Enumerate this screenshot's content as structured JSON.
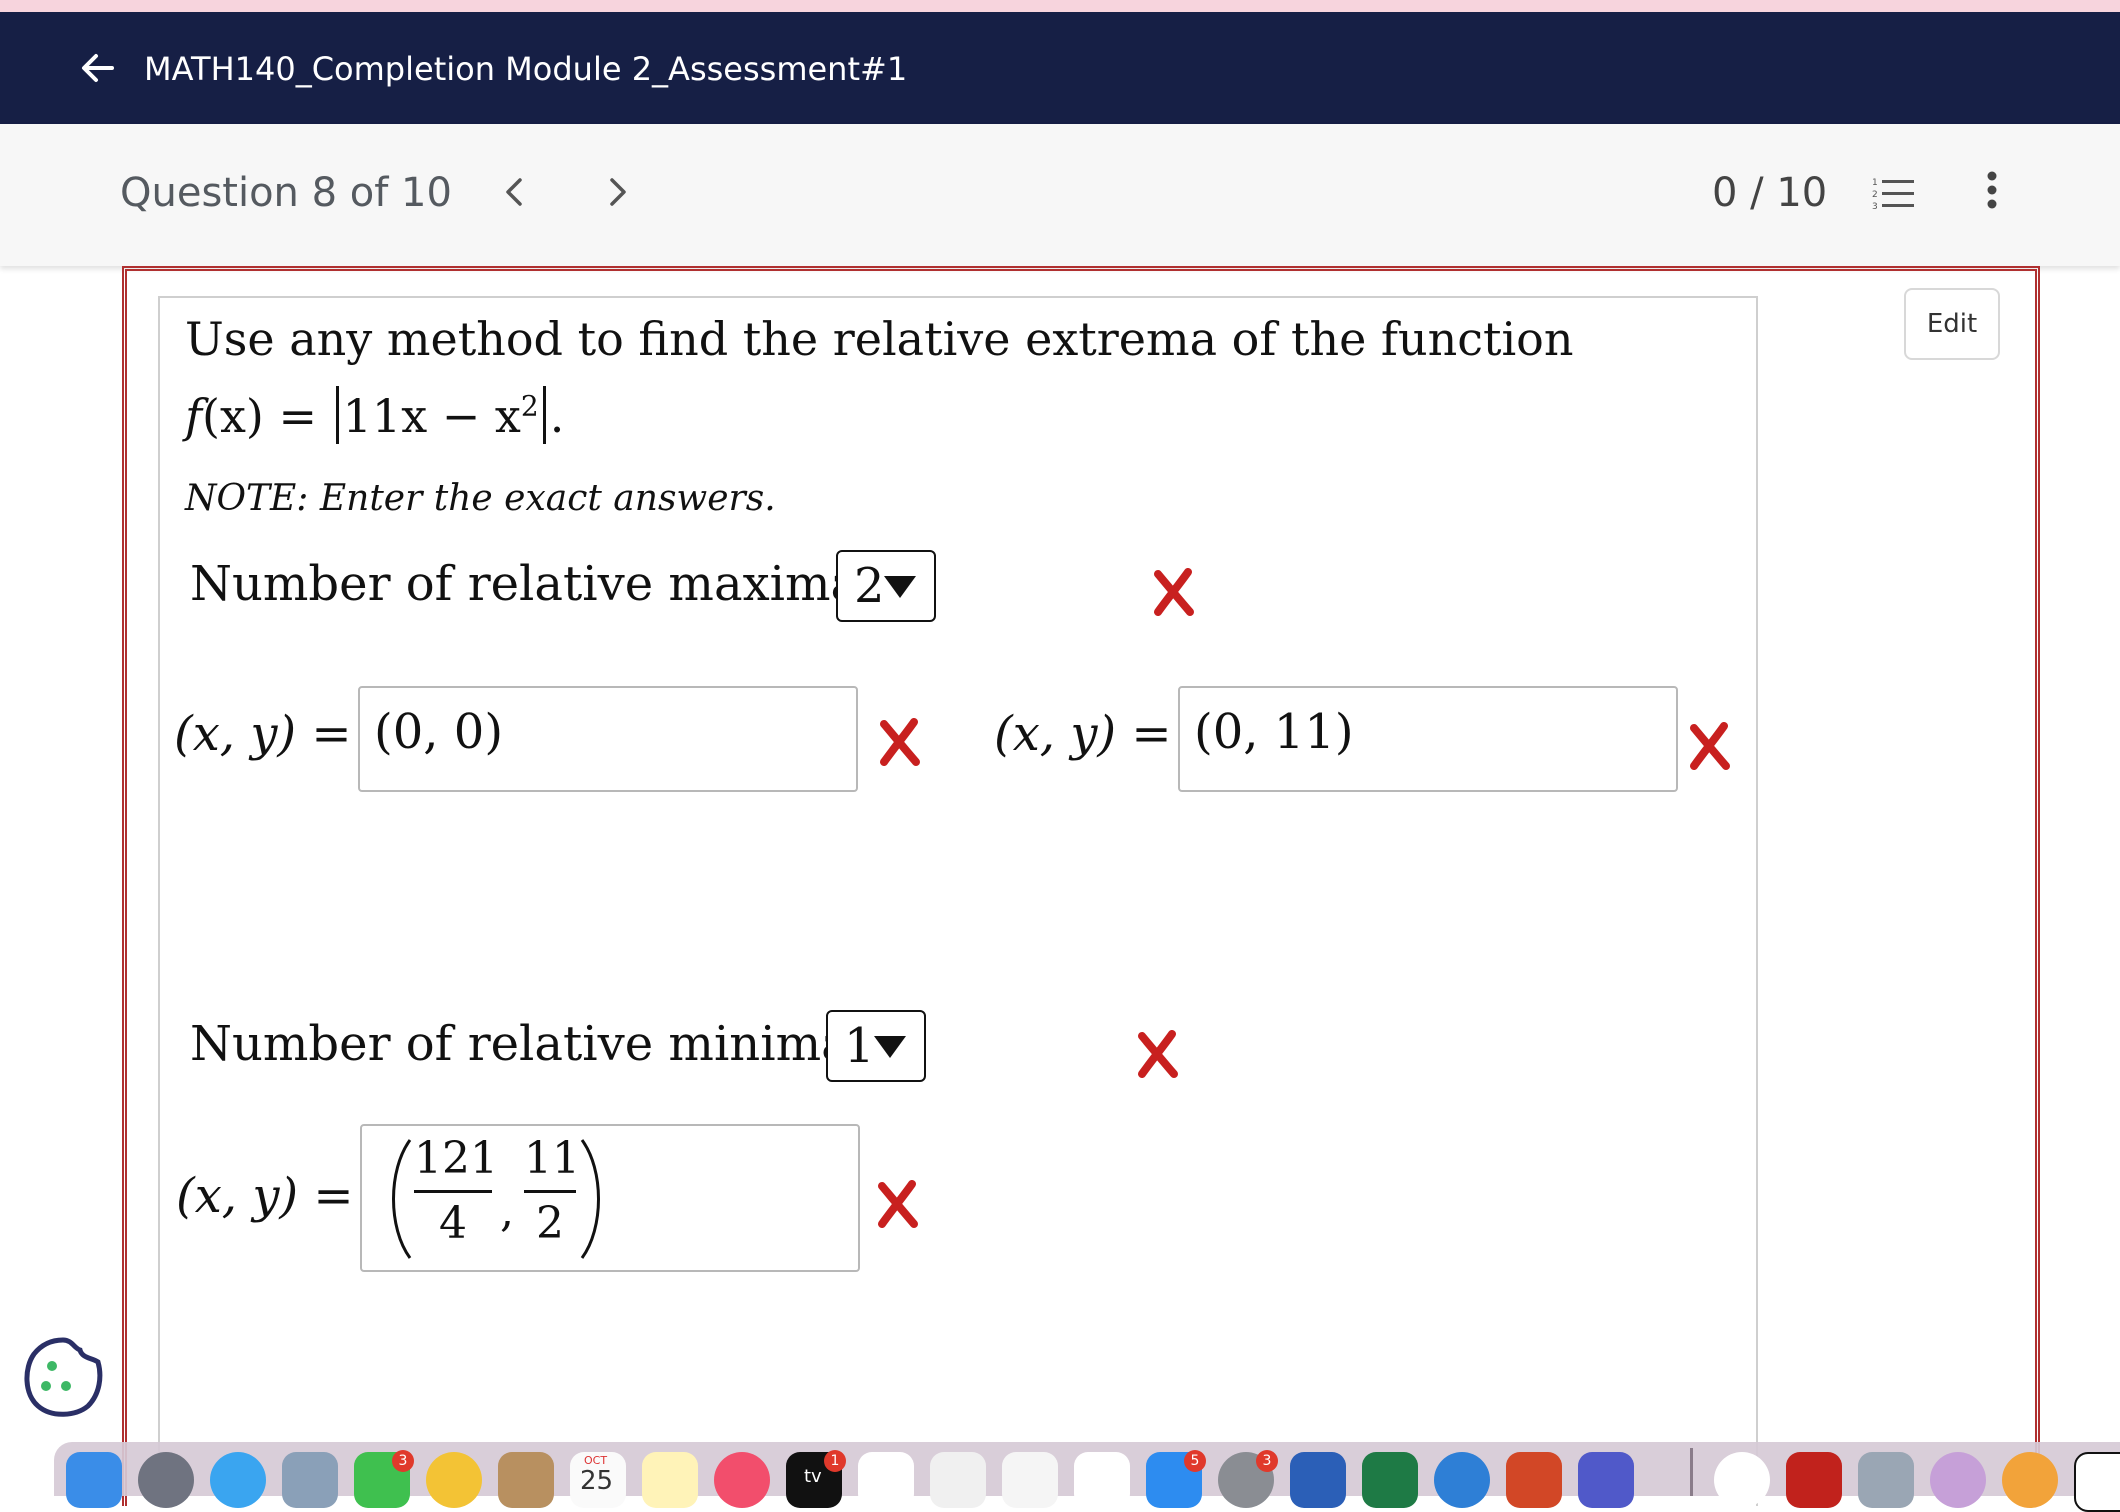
{
  "header": {
    "title": "MATH140_Completion Module 2_Assessment#1",
    "back_icon": "arrow-left-icon"
  },
  "subheader": {
    "question_label": "Question 8 of 10",
    "score": "0 / 10",
    "icons": [
      "chevron-left-icon",
      "chevron-right-icon",
      "numbered-list-icon",
      "more-vertical-icon"
    ]
  },
  "edit_label": "Edit",
  "question": {
    "prompt": "Use any method to find the relative extrema of the function",
    "function_lhs": "f",
    "function_arg": "(x) = ",
    "function_body": "11x − x",
    "function_exp": "2",
    "function_end": ".",
    "note": "NOTE: Enter the exact answers."
  },
  "maxima": {
    "label": "Number of relative maxima:",
    "selected": "2",
    "answers": [
      {
        "lhs": "(x, y) =",
        "value": "(0, 0)",
        "status": "incorrect"
      },
      {
        "lhs": "(x, y) =",
        "value": "(0, 11)",
        "status": "incorrect"
      }
    ],
    "status": "incorrect"
  },
  "minima": {
    "label": "Number of relative minima:",
    "selected": "1",
    "answers": [
      {
        "lhs": "(x, y) =",
        "x_num": "121",
        "x_den": "4",
        "y_num": "11",
        "y_den": "2",
        "status": "incorrect"
      }
    ],
    "status": "incorrect"
  },
  "colors": {
    "header_bg": "#161f45",
    "incorrect": "#c8201f"
  },
  "dock": {
    "badges": {
      "facetime": "3",
      "appletv": "1",
      "appstore": "5",
      "settings": "3"
    },
    "calendar_month": "OCT",
    "calendar_day": "25",
    "appletv_label": "tv"
  }
}
